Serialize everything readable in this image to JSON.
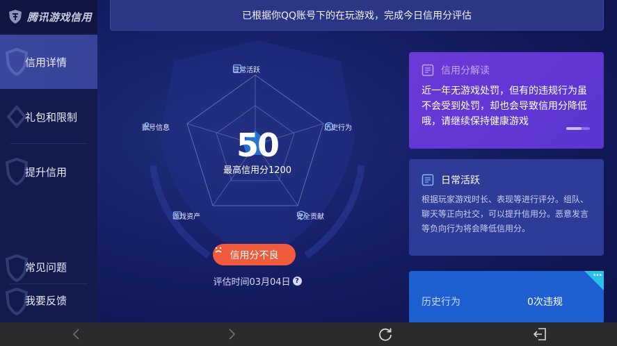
{
  "app": {
    "logo_text": "腾讯游戏信用"
  },
  "sidebar": {
    "items": [
      {
        "label": "信用详情",
        "active": true
      },
      {
        "label": "礼包和限制",
        "active": false
      },
      {
        "label": "提升信用",
        "active": false
      }
    ],
    "bottom_items": [
      {
        "label": "常见问题"
      },
      {
        "label": "我要反馈"
      }
    ]
  },
  "banner": {
    "text": "已根据你QQ账号下的在玩游戏，完成今日信用分评估"
  },
  "radar": {
    "dimensions": [
      {
        "label": "日常活跃",
        "icon": "daily-activity-icon"
      },
      {
        "label": "历史行为",
        "icon": "history-icon"
      },
      {
        "label": "安全贡献",
        "icon": "shield-icon"
      },
      {
        "label": "游戏资产",
        "icon": "assets-icon"
      },
      {
        "label": "账号信息",
        "icon": "account-icon"
      }
    ]
  },
  "score": {
    "value": "50",
    "max_label": "最高信用分1200",
    "status_label": "信用分不良",
    "eval_time": "评估时间03月04日",
    "help_mark": "?"
  },
  "cards": {
    "interpretation": {
      "title": "信用分解读",
      "body": "近一年无游戏处罚，但有的违规行为虽不会受到处罚，却也会导致信用分降低哦，请继续保持健康游戏"
    },
    "daily": {
      "title": "日常活跃",
      "body": "根据玩家游戏时长、表现等进行评分。组队、聊天等正向社交，可以提升信用分。恶意发言等负向行为将会降低信用分。"
    },
    "history": {
      "label": "历史行为",
      "value": "0次违规",
      "more_icon": "•••"
    }
  },
  "colors": {
    "accent_status": "#f05a3d",
    "card_purple": "#6a3ad7",
    "card_blue": "#2f3c97",
    "card_bright_blue": "#1d5fd1",
    "sidebar_active": "#3b469e"
  }
}
